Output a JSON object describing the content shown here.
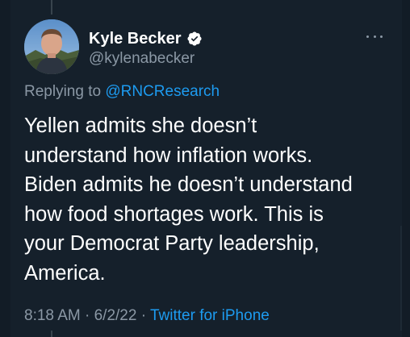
{
  "tweet": {
    "author": {
      "display_name": "Kyle Becker",
      "handle": "@kylenabecker",
      "verified": true,
      "avatar_icon": "profile-photo"
    },
    "more_icon": "ellipsis-icon",
    "reply": {
      "prefix": "Replying to ",
      "target": "@RNCResearch"
    },
    "text": "Yellen admits she doesn’t\nunderstand how inflation works.\nBiden admits he doesn’t understand\nhow food shortages work. This is\nyour Democrat Party leadership,\nAmerica.",
    "meta": {
      "time": "8:18 AM",
      "separator": " · ",
      "date": "6/2/22",
      "source": "Twitter for iPhone"
    }
  },
  "colors": {
    "background": "#15202b",
    "text": "#ffffff",
    "secondary": "#8b98a5",
    "accent": "#1d9bf0"
  }
}
